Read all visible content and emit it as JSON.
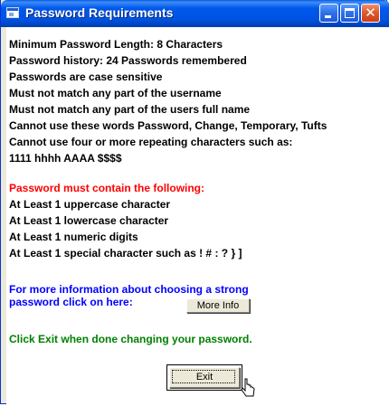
{
  "window": {
    "title": "Password Requirements"
  },
  "requirements": [
    "Minimum Password Length: 8 Characters",
    "Password history: 24 Passwords remembered",
    "Passwords are case sensitive",
    "Must not match any part of the username",
    "Must not match any part of the users full name",
    "Cannot use these words Password, Change, Temporary, Tufts",
    "Cannot use four or more repeating characters such as:",
    "1111 hhhh AAAA $$$$"
  ],
  "must_contain": {
    "heading": "Password must contain the following:",
    "items": [
      "At Least 1 uppercase character",
      "At Least 1 lowercase character",
      "At Least 1 numeric digits",
      "At Least 1 special character such as ! # : ? } ]"
    ]
  },
  "info": {
    "line1": "For more information about choosing a strong",
    "line2": "password click on here:",
    "button_label": "More Info"
  },
  "exit_note": "Click Exit when done changing your password.",
  "exit_button_label": "Exit",
  "colors": {
    "title_bar": "#0054e3",
    "heading_red": "#ff0000",
    "info_blue": "#0000ff",
    "note_green": "#008000"
  },
  "icons": {
    "app": "window-app-icon",
    "minimize": "minimize-icon",
    "maximize": "maximize-icon",
    "close": "close-icon",
    "cursor": "mouse-pointer-icon"
  }
}
